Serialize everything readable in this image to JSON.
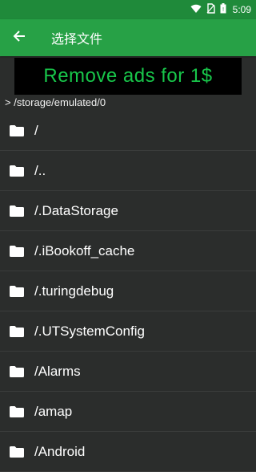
{
  "status_bar": {
    "time": "5:09"
  },
  "app_bar": {
    "title": "选择文件"
  },
  "ad": {
    "text": "Remove ads for 1$"
  },
  "path": {
    "text": "> /storage/emulated/0"
  },
  "files": [
    {
      "name": "/"
    },
    {
      "name": "/.."
    },
    {
      "name": "/.DataStorage"
    },
    {
      "name": "/.iBookoff_cache"
    },
    {
      "name": "/.turingdebug"
    },
    {
      "name": "/.UTSystemConfig"
    },
    {
      "name": "/Alarms"
    },
    {
      "name": "/amap"
    },
    {
      "name": "/Android"
    }
  ],
  "colors": {
    "status_bar": "#1f8a3a",
    "app_bar": "#27a146",
    "background": "#2b2d2c",
    "ad_text": "#18c64a"
  },
  "icons": {
    "back": "arrow-left-icon",
    "folder": "folder-icon",
    "wifi": "wifi-icon",
    "battery": "battery-icon"
  }
}
